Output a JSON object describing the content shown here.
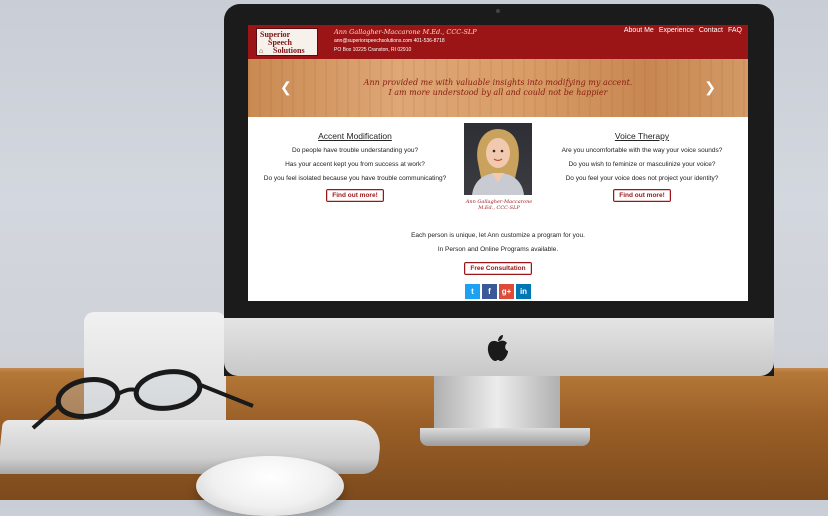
{
  "site": {
    "logo": {
      "line1": "Superior",
      "line2": "Speech",
      "line3": "Solutions"
    },
    "contact": {
      "name": "Ann Gallagher-Maccarone M.Ed., CCC-SLP",
      "email_phone": "ann@superiorspeechsolutions.com 401-536-8718",
      "address": "PO Box 10225 Cranston, RI 02910"
    },
    "nav": [
      "About Me",
      "Experience",
      "Contact",
      "FAQ"
    ],
    "hero": {
      "line1": "Ann provided me with valuable insights into modifying my accent.",
      "line2": "I am more understood by all and could not be happier"
    },
    "accent": {
      "title": "Accent Modification",
      "questions": [
        "Do people have trouble understanding you?",
        "Has your accent kept you from success at work?",
        "Do you feel isolated because you have trouble communicating?"
      ],
      "button": "Find out more!"
    },
    "voice": {
      "title": "Voice Therapy",
      "questions": [
        "Are you uncomfortable with the way your voice sounds?",
        "Do you wish to feminize or masculinize your voice?",
        "Do you feel your voice does not project your identity?"
      ],
      "button": "Find out more!"
    },
    "portrait_caption": {
      "line1": "Ann Gallagher-Maccarone",
      "line2": "M.Ed., CCC-SLP"
    },
    "bottom": {
      "line1": "Each person is unique, let Ann customize a program for you.",
      "line2": "In Person and Online Programs available.",
      "button": "Free Consultation"
    },
    "social": [
      {
        "name": "twitter",
        "glyph": "t",
        "color": "#1da1f2"
      },
      {
        "name": "facebook",
        "glyph": "f",
        "color": "#3b5998"
      },
      {
        "name": "google-plus",
        "glyph": "g+",
        "color": "#dd4b39"
      },
      {
        "name": "linkedin",
        "glyph": "in",
        "color": "#0077b5"
      }
    ]
  },
  "colors": {
    "brand_red": "#9b1516",
    "desk": "#9a5f27"
  }
}
